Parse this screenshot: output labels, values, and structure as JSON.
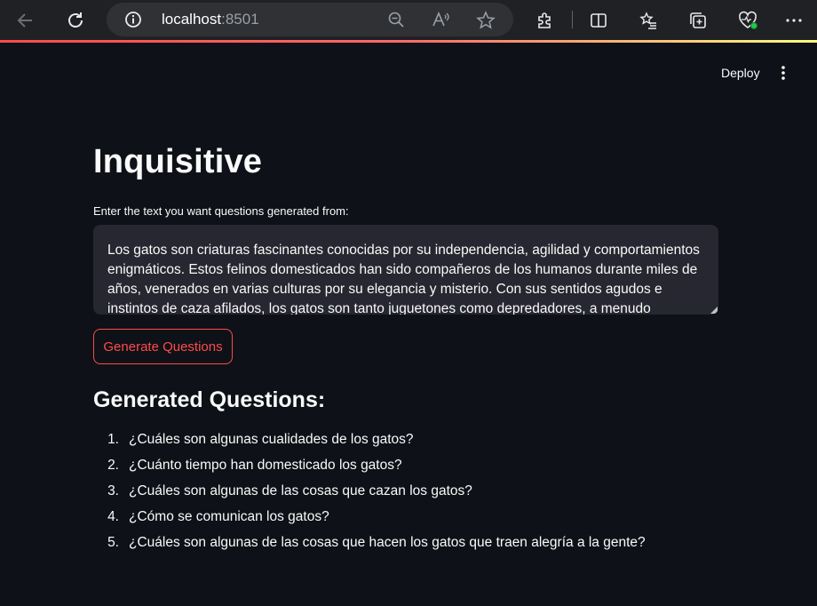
{
  "browser": {
    "url_host": "localhost",
    "url_port": ":8501"
  },
  "header": {
    "deploy_label": "Deploy"
  },
  "main": {
    "title": "Inquisitive",
    "input_label": "Enter the text you want questions generated from:",
    "input_value": "Los gatos son criaturas fascinantes conocidas por su independencia, agilidad y comportamientos enigmáticos. Estos felinos domesticados han sido compañeros de los humanos durante miles de años, venerados en varias culturas por su elegancia y misterio. Con sus sentidos agudos e instintos de caza afilados, los gatos son tanto juguetones como depredadores, a menudo mostrando",
    "button_label": "Generate Questions",
    "results_heading": "Generated Questions:",
    "questions": [
      {
        "num": "1.",
        "text": "¿Cuáles son algunas cualidades de los gatos?"
      },
      {
        "num": "2.",
        "text": "¿Cuánto tiempo han domesticado los gatos?"
      },
      {
        "num": "3.",
        "text": "¿Cuáles son algunas de las cosas que cazan los gatos?"
      },
      {
        "num": "4.",
        "text": "¿Cómo se comunican los gatos?"
      },
      {
        "num": "5.",
        "text": "¿Cuáles son algunas de las cosas que hacen los gatos que traen alegría a la gente?"
      }
    ]
  },
  "colors": {
    "background": "#0e1117",
    "input_background": "#262730",
    "accent": "#ff4b4b",
    "text": "#fafafa"
  }
}
